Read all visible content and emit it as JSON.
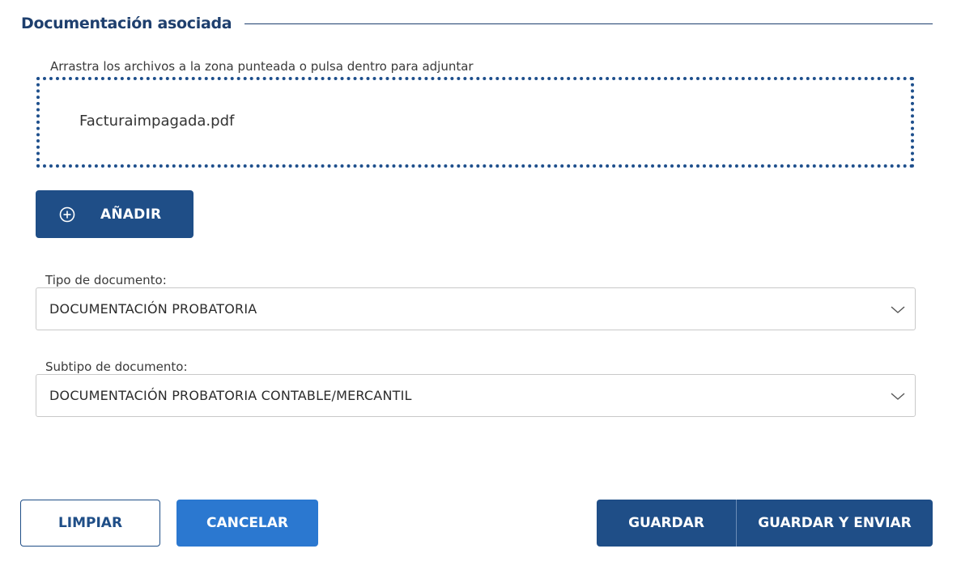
{
  "section": {
    "title": "Documentación asociada"
  },
  "dropzone": {
    "label": "Arrastra los archivos a la zona punteada o pulsa dentro para adjuntar",
    "files": [
      "Facturaimpagada.pdf"
    ]
  },
  "add_button": {
    "label": "AÑADIR",
    "icon": "plus-circle-icon"
  },
  "document_type": {
    "label": "Tipo de documento:",
    "value": "DOCUMENTACIÓN PROBATORIA"
  },
  "document_subtype": {
    "label": "Subtipo de documento:",
    "value": "DOCUMENTACIÓN PROBATORIA CONTABLE/MERCANTIL"
  },
  "actions": {
    "clear": "LIMPIAR",
    "cancel": "CANCELAR",
    "save": "GUARDAR",
    "save_send": "GUARDAR Y ENVIAR"
  },
  "colors": {
    "primary": "#1f4e87",
    "title": "#1e3f6e",
    "cancel": "#2b78d0",
    "border": "#c9c9c9"
  }
}
